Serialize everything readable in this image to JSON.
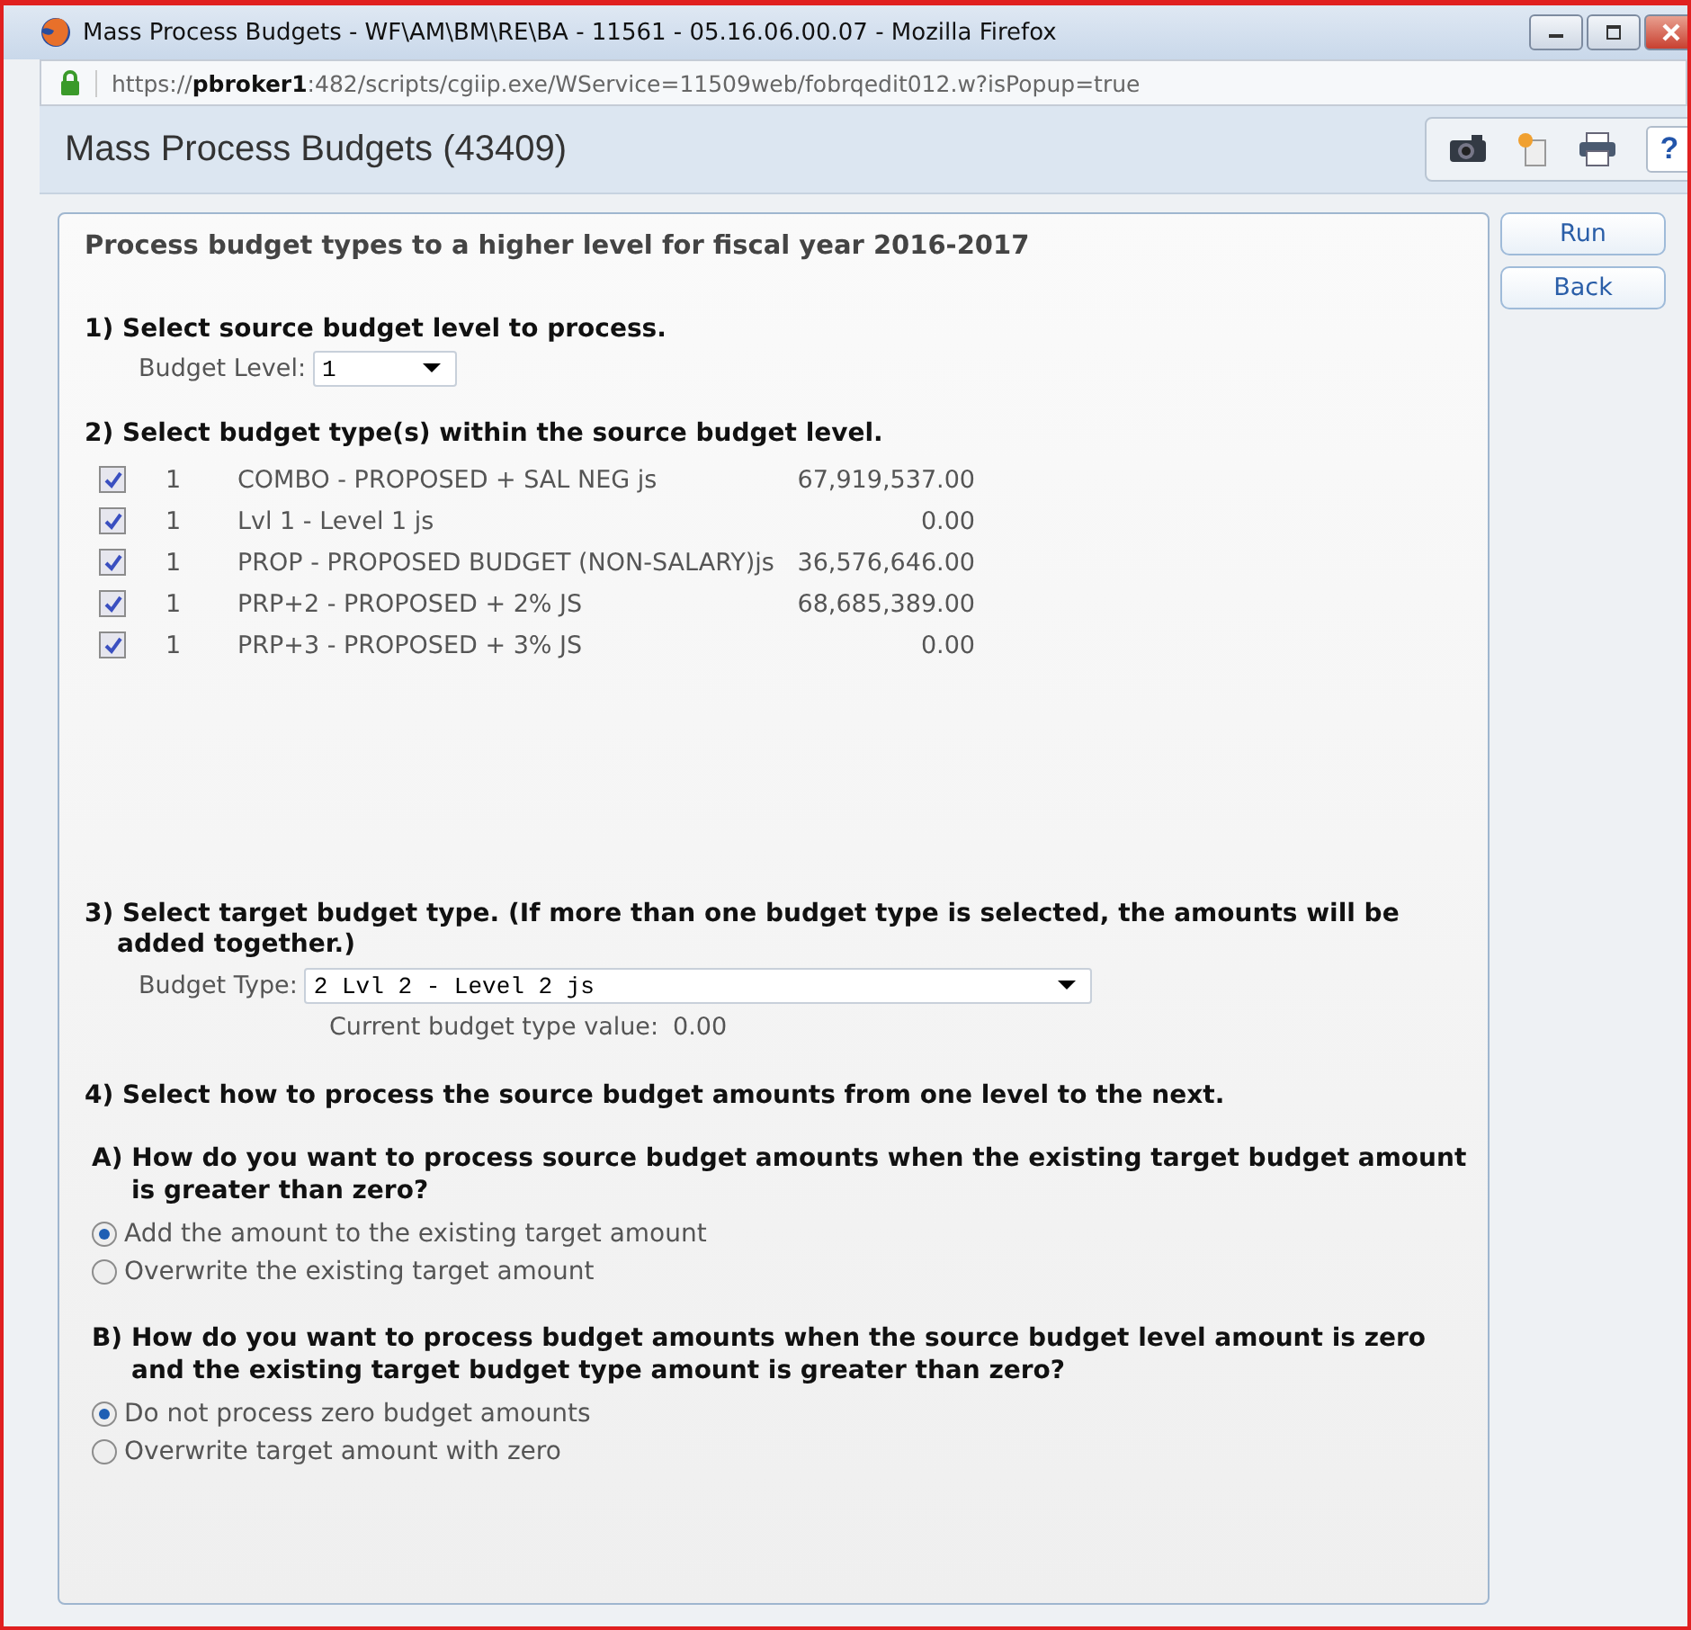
{
  "window": {
    "title": "Mass Process Budgets - WF\\AM\\BM\\RE\\BA - 11561 - 05.16.06.00.07 - Mozilla Firefox",
    "url": "https://**pbroker1**:482/scripts/cgiip.exe/WService=11509web/fobrqedit012.w?isPopup=true"
  },
  "header": {
    "title": "Mass Process Budgets (43409)",
    "help": "?"
  },
  "intro": "Process budget types to a higher level for fiscal year 2016-2017",
  "step1": {
    "heading": "1) Select source budget level to process.",
    "label": "Budget Level:",
    "value": "1"
  },
  "step2": {
    "heading": "2) Select budget type(s) within the source budget level.",
    "rows": [
      {
        "checked": true,
        "level": "1",
        "name": "COMBO - PROPOSED + SAL NEG js",
        "amount": "67,919,537.00"
      },
      {
        "checked": true,
        "level": "1",
        "name": "Lvl 1 - Level 1 js",
        "amount": "0.00"
      },
      {
        "checked": true,
        "level": "1",
        "name": "PROP - PROPOSED BUDGET (NON-SALARY)js",
        "amount": "36,576,646.00"
      },
      {
        "checked": true,
        "level": "1",
        "name": "PRP+2 - PROPOSED + 2% JS",
        "amount": "68,685,389.00"
      },
      {
        "checked": true,
        "level": "1",
        "name": "PRP+3 - PROPOSED + 3% JS",
        "amount": "0.00"
      }
    ]
  },
  "step3": {
    "heading": "3) Select target budget type.  (If more than one budget type is selected, the amounts will be added together.)",
    "label": "Budget Type:",
    "value": "2 Lvl 2 - Level 2 js",
    "current_label": "Current budget type value:",
    "current_value": "0.00"
  },
  "step4": {
    "heading": "4) Select how to process the source budget amounts from one level to the next.",
    "questions": [
      {
        "text": "A) How do you want to process source budget amounts when the existing target budget amount is greater than zero?",
        "options": [
          {
            "label": "Add the amount to the existing target amount",
            "selected": true
          },
          {
            "label": "Overwrite the existing target amount",
            "selected": false
          }
        ]
      },
      {
        "text": "B) How do you want to process budget amounts when the source budget level amount is zero and the existing target budget type amount is greater than zero?",
        "options": [
          {
            "label": "Do not process zero budget amounts",
            "selected": true
          },
          {
            "label": "Overwrite target amount with zero",
            "selected": false
          }
        ]
      }
    ]
  },
  "buttons": [
    "Run",
    "Back"
  ]
}
